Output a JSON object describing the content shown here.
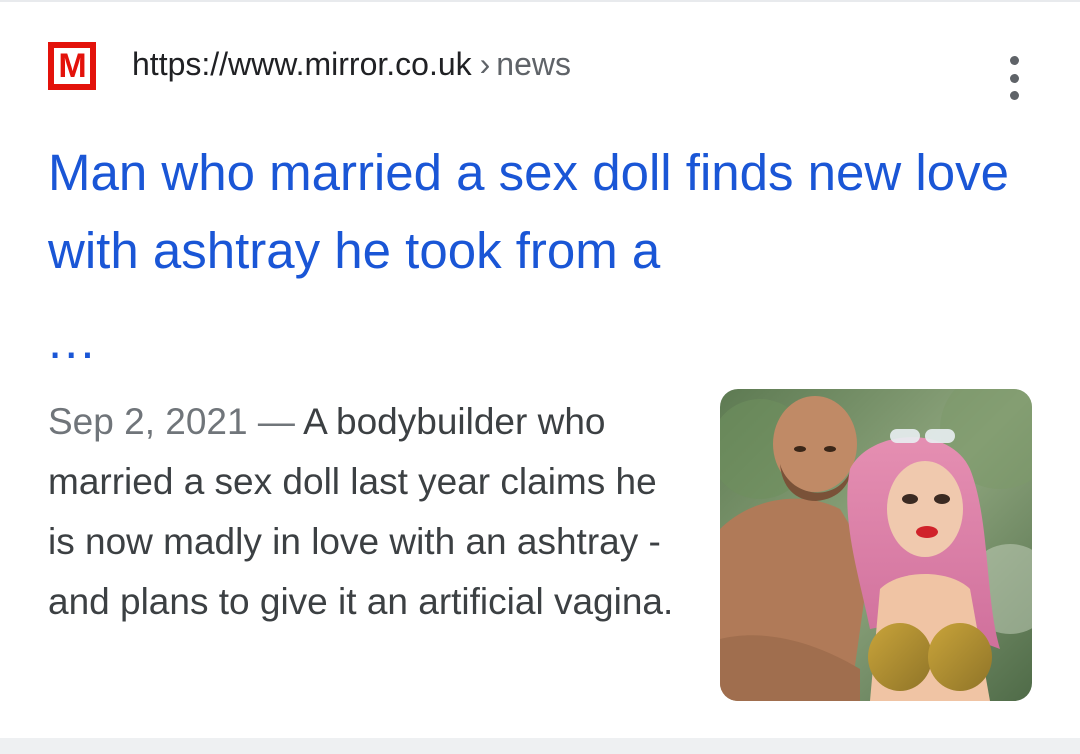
{
  "result": {
    "favicon_letter": "M",
    "url": "https://www.mirror.co.uk",
    "breadcrumb_separator": "›",
    "breadcrumb_path": "news",
    "menu_icon": "more-vert-icon",
    "title": "Man who married a sex doll finds new love with ashtray he took from a",
    "title_ellipsis": "...",
    "date": "Sep 2, 2021",
    "dash": "—",
    "snippet": "A bodybuilder who married a sex doll last year claims he is now madly in love with an ashtray - and plans to give it an artificial vagina.",
    "thumbnail": "article-thumbnail-photo"
  },
  "colors": {
    "link": "#1a56d6",
    "favicon_red": "#e3120b",
    "text_secondary": "#70757a"
  }
}
